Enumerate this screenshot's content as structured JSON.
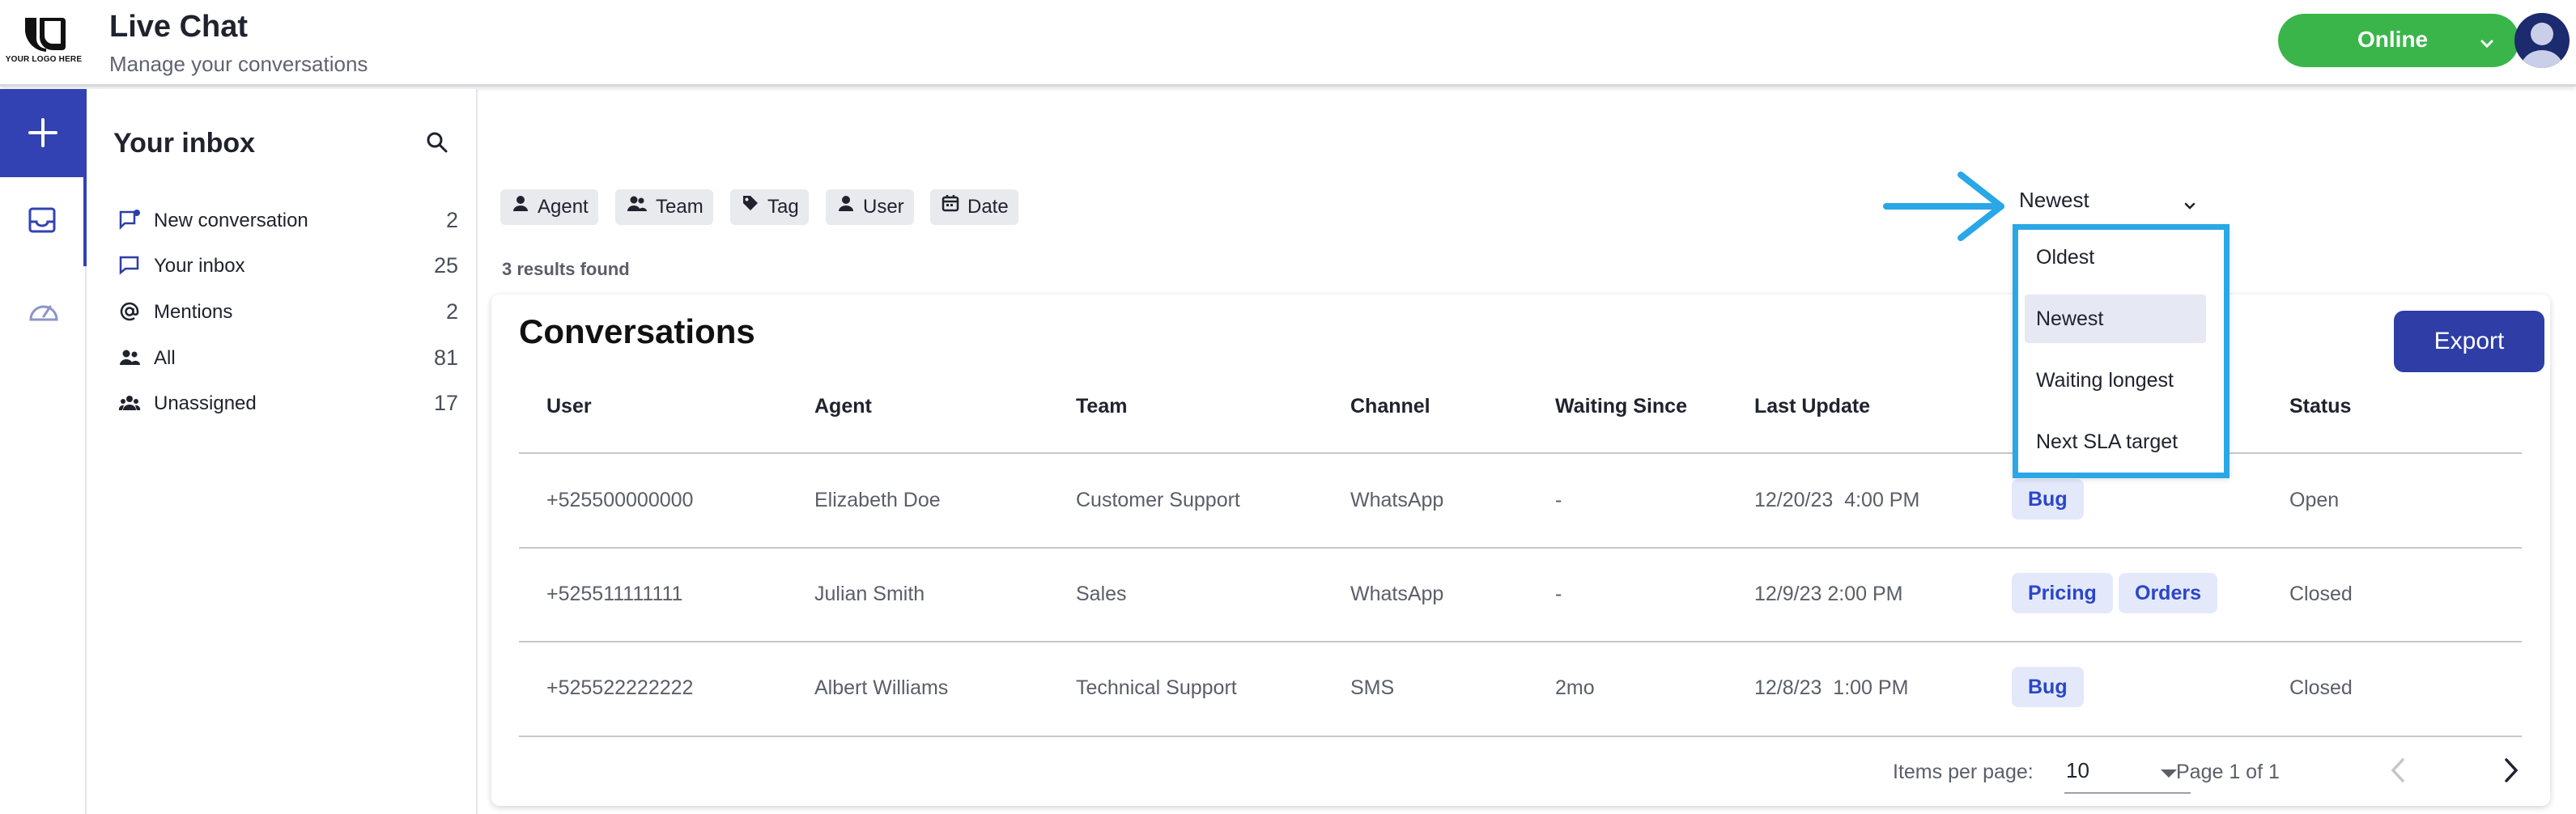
{
  "header": {
    "logo_text": "YOUR LOGO HERE",
    "title": "Live Chat",
    "subtitle": "Manage your conversations",
    "status_label": "Online",
    "status_color": "#3ab54a"
  },
  "rail": {
    "accent": "#3242b3",
    "items": [
      {
        "icon": "plus-icon"
      },
      {
        "icon": "inbox-icon"
      },
      {
        "icon": "dashboard-icon"
      }
    ]
  },
  "inbox": {
    "title": "Your inbox",
    "items": [
      {
        "icon": "new-conversation-icon",
        "label": "New conversation",
        "count": "2"
      },
      {
        "icon": "chat-bubble-icon",
        "label": "Your inbox",
        "count": "25"
      },
      {
        "icon": "at-sign-icon",
        "label": "Mentions",
        "count": "2"
      },
      {
        "icon": "people-icon",
        "label": "All",
        "count": "81"
      },
      {
        "icon": "group-icon",
        "label": "Unassigned",
        "count": "17"
      }
    ]
  },
  "filters": [
    {
      "icon": "person-icon",
      "label": "Agent"
    },
    {
      "icon": "team-icon",
      "label": "Team"
    },
    {
      "icon": "tag-icon",
      "label": "Tag"
    },
    {
      "icon": "person-icon",
      "label": "User"
    },
    {
      "icon": "calendar-icon",
      "label": "Date"
    }
  ],
  "results_text": "3 results found",
  "sort": {
    "selected": "Newest",
    "options": [
      "Oldest",
      "Newest",
      "Waiting longest",
      "Next SLA target"
    ]
  },
  "conversations": {
    "title": "Conversations",
    "export_label": "Export",
    "columns": [
      "User",
      "Agent",
      "Team",
      "Channel",
      "Waiting Since",
      "Last Update",
      "Status"
    ],
    "rows": [
      {
        "user": "+525500000000",
        "agent": "Elizabeth Doe",
        "team": "Customer Support",
        "channel": "WhatsApp",
        "waiting": "-",
        "updated": "12/20/23  4:00 PM",
        "tags": [
          "Bug"
        ],
        "status": "Open"
      },
      {
        "user": "+525511111111",
        "agent": "Julian Smith",
        "team": "Sales",
        "channel": "WhatsApp",
        "waiting": "-",
        "updated": "12/9/23 2:00 PM",
        "tags": [
          "Pricing",
          "Orders"
        ],
        "status": "Closed"
      },
      {
        "user": "+525522222222",
        "agent": "Albert Williams",
        "team": "Technical Support",
        "channel": "SMS",
        "waiting": "2mo",
        "updated": "12/8/23  1:00 PM",
        "tags": [
          "Bug"
        ],
        "status": "Closed"
      }
    ]
  },
  "pagination": {
    "items_per_page_label": "Items per page:",
    "items_per_page": "10",
    "page_text": "Page 1 of 1"
  },
  "colors": {
    "primary": "#2e3ea6",
    "highlight": "#2aa7e6",
    "tag_bg": "#e3e9fb",
    "tag_text": "#2a46c8"
  }
}
